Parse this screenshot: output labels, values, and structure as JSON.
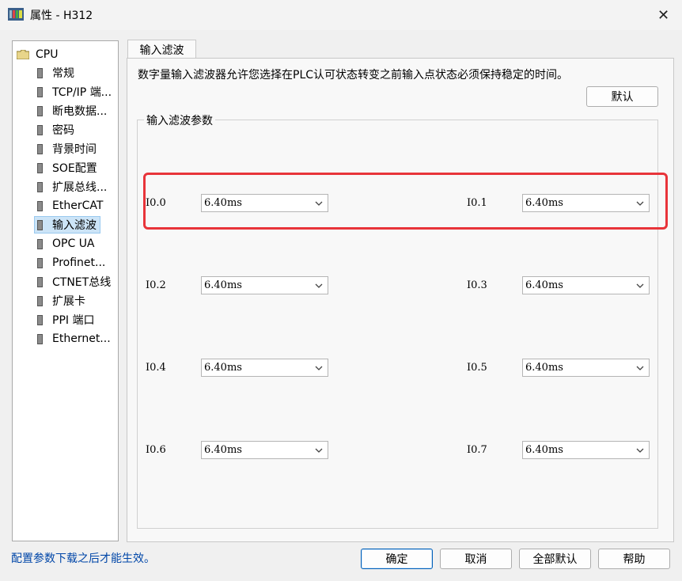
{
  "window": {
    "title": "属性 - H312",
    "close_glyph": "✕"
  },
  "tree": {
    "root": "CPU",
    "items": [
      {
        "label": "常规"
      },
      {
        "label": "TCP/IP 端..."
      },
      {
        "label": "断电数据..."
      },
      {
        "label": "密码"
      },
      {
        "label": "背景时间"
      },
      {
        "label": "SOE配置"
      },
      {
        "label": "扩展总线..."
      },
      {
        "label": "EtherCAT"
      },
      {
        "label": "输入滤波",
        "selected": true
      },
      {
        "label": "OPC UA"
      },
      {
        "label": "Profinet..."
      },
      {
        "label": "CTNET总线"
      },
      {
        "label": "扩展卡"
      },
      {
        "label": "PPI 端口"
      },
      {
        "label": "Ethernet..."
      }
    ]
  },
  "tab": {
    "label": "输入滤波"
  },
  "panel": {
    "description": "数字量输入滤波器允许您选择在PLC认可状态转变之前输入点状态必须保持稳定的时间。",
    "default_button": "默认",
    "group_title": "输入滤波参数",
    "filters": [
      {
        "label": "I0.0",
        "value": "6.40ms"
      },
      {
        "label": "I0.1",
        "value": "6.40ms"
      },
      {
        "label": "I0.2",
        "value": "6.40ms"
      },
      {
        "label": "I0.3",
        "value": "6.40ms"
      },
      {
        "label": "I0.4",
        "value": "6.40ms"
      },
      {
        "label": "I0.5",
        "value": "6.40ms"
      },
      {
        "label": "I0.6",
        "value": "6.40ms"
      },
      {
        "label": "I0.7",
        "value": "6.40ms"
      }
    ]
  },
  "footer": {
    "message": "配置参数下载之后才能生效。",
    "ok": "确定",
    "cancel": "取消",
    "all_default": "全部默认",
    "help": "帮助"
  },
  "colors": {
    "highlight": "#e8343a",
    "link_text": "#0046a8",
    "selection": "#cce4f7"
  }
}
